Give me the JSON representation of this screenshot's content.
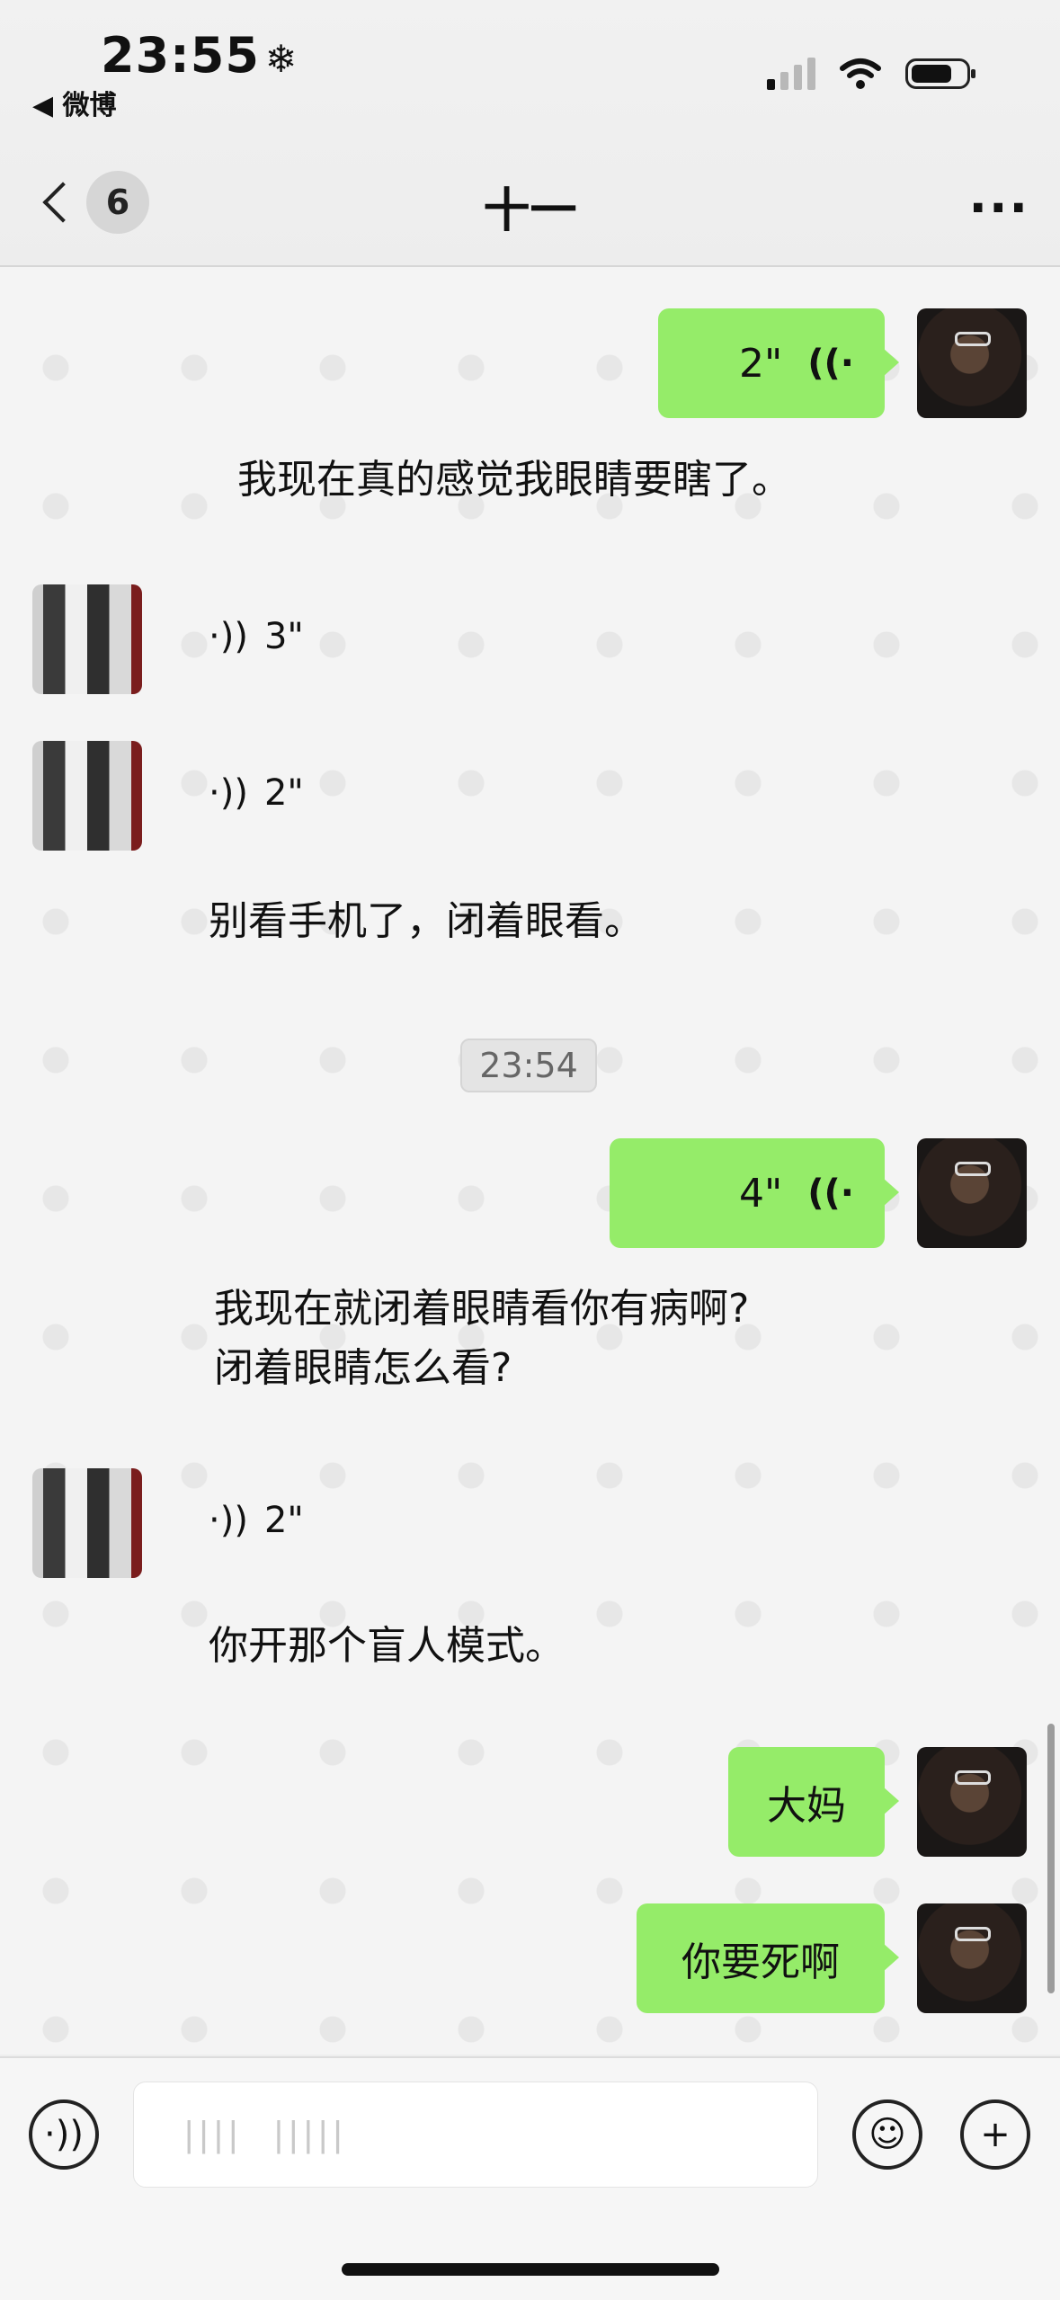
{
  "status_bar": {
    "time": "23:55",
    "weather_glyph": "❄",
    "back_app": "◀ 微博",
    "icons": [
      "signal-icon",
      "wifi-icon",
      "battery-icon"
    ]
  },
  "header": {
    "unread_count": "6",
    "title": "十一",
    "more_glyph": "···"
  },
  "messages": [
    {
      "sender": "me",
      "type": "voice",
      "duration": "2\"",
      "icon": "((·"
    },
    {
      "sender": "me",
      "type": "transcript",
      "text": "我现在真的感觉我眼睛要瞎了。"
    },
    {
      "sender": "them",
      "type": "voice",
      "duration": "3\"",
      "icon": "·))"
    },
    {
      "sender": "them",
      "type": "voice",
      "duration": "2\"",
      "icon": "·))"
    },
    {
      "sender": "them",
      "type": "transcript",
      "text": "别看手机了，闭着眼看。"
    },
    {
      "type": "timestamp",
      "text": "23:54"
    },
    {
      "sender": "me",
      "type": "voice",
      "duration": "4\"",
      "icon": "((·"
    },
    {
      "sender": "me",
      "type": "transcript",
      "lines": [
        "我现在就闭着眼睛看你有病啊?",
        "闭着眼睛怎么看?"
      ]
    },
    {
      "sender": "them",
      "type": "voice",
      "duration": "2\"",
      "icon": "·))"
    },
    {
      "sender": "them",
      "type": "transcript",
      "text": "你开那个盲人模式。"
    },
    {
      "sender": "me",
      "type": "text",
      "text": "大妈"
    },
    {
      "sender": "me",
      "type": "text",
      "text": "你要死啊"
    }
  ],
  "input_bar": {
    "voice_glyph": "·))",
    "input_value": "||||  |||||",
    "emoji_glyph": "☺",
    "plus_glyph": "+"
  },
  "colors": {
    "my_bubble": "#95ec69",
    "chat_background": "#f4f4f4"
  }
}
